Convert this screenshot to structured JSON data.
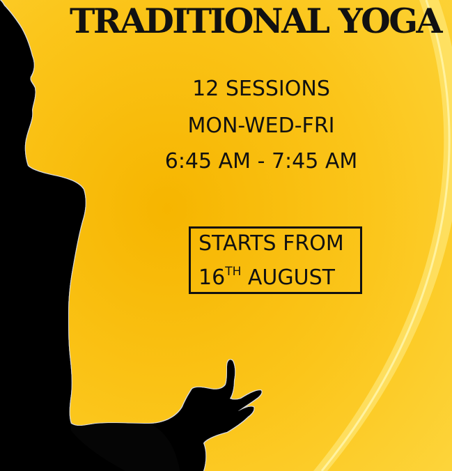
{
  "poster": {
    "title": "TRADITIONAL YOGA",
    "sessions": "12 SESSIONS",
    "days": "MON-WED-FRI",
    "time": "6:45 AM - 7:45 AM",
    "starts_label": "STARTS FROM",
    "start_day": "16",
    "start_day_suffix": "TH",
    "start_month": "AUGUST"
  },
  "colors": {
    "background_deep": "#f6b500",
    "background_light": "#fee56a",
    "silhouette": "#050505",
    "text": "#111111"
  },
  "icons": {
    "figure": "meditating-person-silhouette"
  }
}
